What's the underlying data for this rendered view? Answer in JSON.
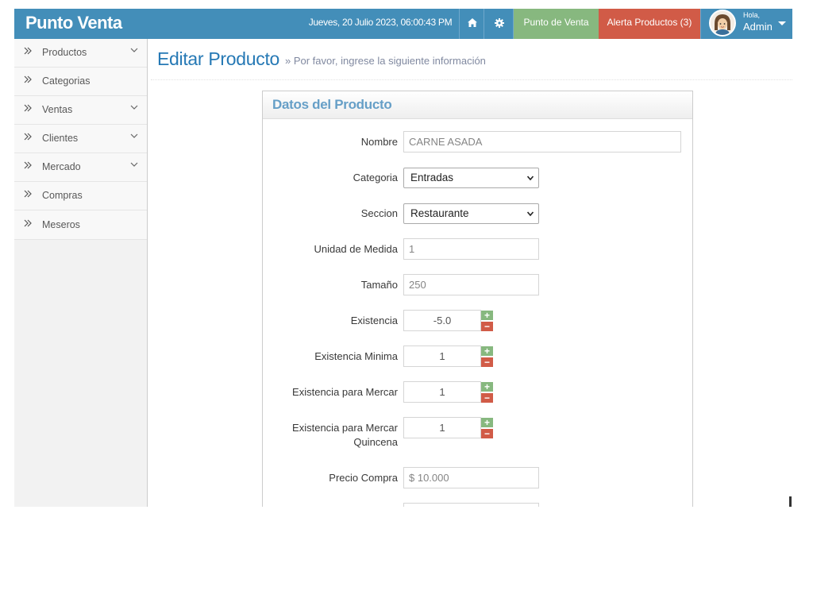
{
  "navbar": {
    "brand": "Punto Venta",
    "datetime": "Jueves, 20 Julio 2023, 06:00:43 PM",
    "home_icon": "home-icon",
    "settings_icon": "gear-icon",
    "punto_venta_label": "Punto de Venta",
    "alert_label": "Alerta Productos (3)",
    "user_greeting": "Hola,",
    "user_name": "Admin"
  },
  "sidebar": {
    "items": [
      {
        "label": "Productos",
        "has_submenu": true
      },
      {
        "label": "Categorias",
        "has_submenu": false
      },
      {
        "label": "Ventas",
        "has_submenu": true
      },
      {
        "label": "Clientes",
        "has_submenu": true
      },
      {
        "label": "Mercado",
        "has_submenu": true
      },
      {
        "label": "Compras",
        "has_submenu": false
      },
      {
        "label": "Meseros",
        "has_submenu": false
      }
    ]
  },
  "page": {
    "title": "Editar Producto",
    "subtitle": "» Por favor, ingrese la siguiente información"
  },
  "form": {
    "header": "Datos del Producto",
    "fields": {
      "nombre": {
        "label": "Nombre",
        "value": "CARNE ASADA"
      },
      "categoria": {
        "label": "Categoria",
        "value": "Entradas"
      },
      "seccion": {
        "label": "Seccion",
        "value": "Restaurante"
      },
      "unidad": {
        "label": "Unidad de Medida",
        "value": "1"
      },
      "tamano": {
        "label": "Tamaño",
        "value": "250"
      },
      "existencia": {
        "label": "Existencia",
        "value": "-5.0"
      },
      "existencia_minima": {
        "label": "Existencia Minima",
        "value": "1"
      },
      "existencia_mercar": {
        "label": "Existencia para Mercar",
        "value": "1"
      },
      "existencia_quincena": {
        "label_line1": "Existencia para Mercar",
        "label_line2": "Quincena",
        "value": "1"
      },
      "precio_compra": {
        "label": "Precio Compra",
        "value": "$ 10.000"
      }
    },
    "spinner": {
      "plus": "+",
      "minus": "−"
    }
  },
  "colors": {
    "navbar": "#438eb9",
    "success": "#87b87f",
    "danger": "#d15b47",
    "title": "#2679b5",
    "widget_title": "#669fc7"
  }
}
